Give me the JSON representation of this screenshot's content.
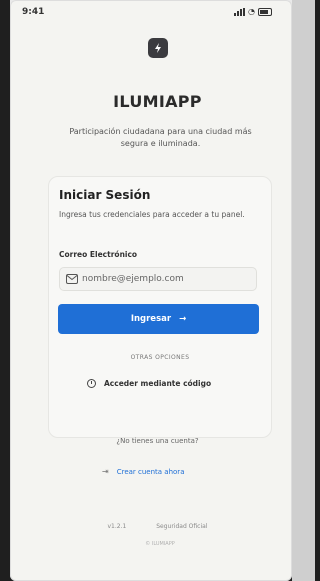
{
  "status_bar": {
    "time": "9:41"
  },
  "app": {
    "title": "ILUMIAPP",
    "tagline": "Participación ciudadana para una ciudad más segura e iluminada."
  },
  "login": {
    "title": "Iniciar Sesión",
    "subtitle": "Ingresa tus credenciales para acceder a tu panel.",
    "email_label": "Correo Electrónico",
    "email_placeholder": "nombre@ejemplo.com",
    "submit_label": "Ingresar",
    "other_options": "OTRAS OPCIONES",
    "code_access_label": "Acceder mediante código"
  },
  "signup": {
    "prompt": "¿No tienes una cuenta?",
    "create_label": "Crear cuenta ahora"
  },
  "footer": {
    "version": "v1.2.1",
    "secure": "Seguridad Oficial",
    "copyright": "© ILUMIAPP"
  },
  "colors": {
    "accent": "#1f6fd6",
    "background": "#f4f4f1"
  }
}
